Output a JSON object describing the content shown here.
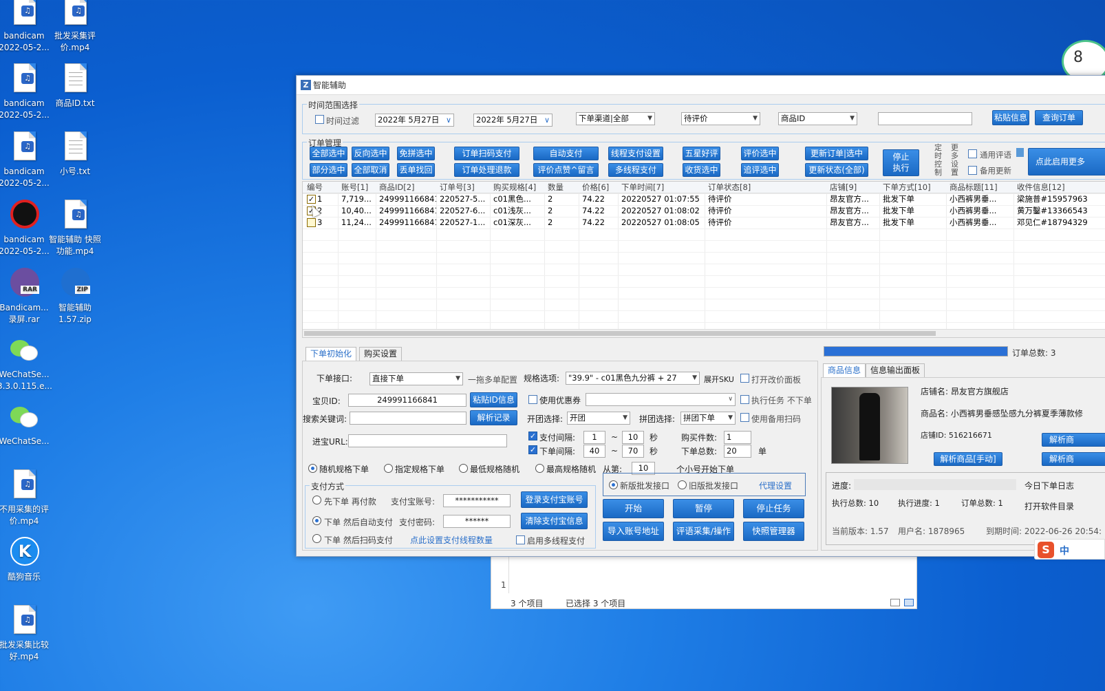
{
  "desktop": {
    "icons": [
      {
        "label": "bandicam 2022-05-2...",
        "type": "audio"
      },
      {
        "label": "批发采集评价.mp4",
        "type": "audio"
      },
      {
        "label": "bandicam 2022-05-2...",
        "type": "audio"
      },
      {
        "label": "商品ID.txt",
        "type": "text"
      },
      {
        "label": "bandicam 2022-05-2...",
        "type": "audio"
      },
      {
        "label": "小号.txt",
        "type": "text"
      },
      {
        "label": "bandicam 2022-05-2...",
        "type": "bandicam"
      },
      {
        "label": "智能辅助 快照功能.mp4",
        "type": "audio"
      },
      {
        "label": "Bandicam... 录屏.rar",
        "type": "rar",
        "badge": "RAR"
      },
      {
        "label": "智能辅助1.57.zip",
        "type": "zip",
        "badge": "ZIP"
      },
      {
        "label": "WeChatSe... 3.3.0.115.e...",
        "type": "wechat"
      },
      {
        "label": "WeChatSe...",
        "type": "wechat"
      },
      {
        "label": "不用采集的评价.mp4",
        "type": "audio"
      },
      {
        "label": "酷狗音乐",
        "type": "kugou",
        "glyph": "K"
      },
      {
        "label": "批发采集比较好.mp4",
        "type": "audio"
      }
    ]
  },
  "window": {
    "title": "智能辅助",
    "logo": "Z",
    "time_group": {
      "legend": "时间范围选择",
      "time_filter_label": "时间过滤",
      "date_from": "2022年 5月27日",
      "date_to": "2022年 5月27日",
      "channel": "下单渠道|全部",
      "status": "待评价",
      "id_type": "商品ID",
      "search_value": "",
      "paste_btn": "粘贴信息",
      "query_btn": "查询订单"
    },
    "order_group": {
      "legend": "订单管理",
      "buttons_row1": [
        "全部选中",
        "反向选中",
        "免拼选中",
        "订单扫码支付",
        "自动支付",
        "线程支付设置",
        "五星好评",
        "评价选中",
        "更新订单|选中"
      ],
      "buttons_row2": [
        "部分选中",
        "全部取消",
        "丢单找回",
        "订单处理退款",
        "评价点赞^留言",
        "多线程支付",
        "收货选中",
        "追评选中",
        "更新状态(全部)"
      ],
      "stop_btn": "停止执行",
      "vert1": "定时控制",
      "vert2": "更多设置",
      "general_review": "通用评语",
      "backup_update": "备用更新",
      "enable_more": "点此启用更多"
    },
    "table": {
      "headers": [
        "编号",
        "账号[1]",
        "商品ID[2]",
        "订单号[3]",
        "购买规格[4]",
        "数量",
        "价格[6]",
        "下单时间[7]",
        "订单状态[8]",
        "店铺[9]",
        "下单方式[10]",
        "商品标题[11]",
        "收件信息[12]"
      ],
      "rows": [
        {
          "checked": true,
          "cells": [
            "1",
            "7,719...",
            "249991166841",
            "220527-5...",
            "c01黑色...",
            "2",
            "74.22",
            "20220527 01:07:55",
            "待评价",
            "昂友官方...",
            "批发下单",
            "小西裤男垂...",
            "梁施普#15957963"
          ]
        },
        {
          "checked": true,
          "cells": [
            "2",
            "10,40...",
            "249991166841",
            "220527-6...",
            "c01浅灰...",
            "2",
            "74.22",
            "20220527 01:08:02",
            "待评价",
            "昂友官方...",
            "批发下单",
            "小西裤男垂...",
            "黄万鑿#13366543"
          ]
        },
        {
          "checked": false,
          "cells": [
            "3",
            "11,24...",
            "249991166841",
            "220527-1...",
            "c01深灰...",
            "2",
            "74.22",
            "20220527 01:08:05",
            "待评价",
            "昂友官方...",
            "批发下单",
            "小西裤男垂...",
            "邓见仁#18794329"
          ]
        }
      ]
    },
    "bottom": {
      "tabs": [
        "下单初始化",
        "购买设置"
      ],
      "progress_value": 1.0,
      "order_total_label": "订单总数: 3",
      "order_api_label": "下单接口:",
      "order_api_value": "直接下单",
      "multi_config": "一拖多单配置",
      "sku_label": "规格选项:",
      "sku_value": "\"39.9\" - c01黑色九分裤 + 27",
      "expand_sku": "展开SKU",
      "open_price_panel": "打开改价面板",
      "item_id_label": "宝贝ID:",
      "item_id_value": "249991166841",
      "paste_id_btn": "粘贴ID信息",
      "use_coupon": "使用优惠券",
      "exec_task": "执行任务 不下单",
      "keyword_label": "搜索关键词:",
      "parse_record_btn": "解析记录",
      "group_open_label": "开团选择:",
      "group_open_value": "开团",
      "group_join_label": "拼团选择:",
      "group_join_value": "拼团下单",
      "backup_scan": "使用备用扫码",
      "url_label": "进宝URL:",
      "pay_interval_label": "支付间隔:",
      "pay_interval_from": "1",
      "pay_interval_to": "10",
      "sec": "秒",
      "dash": "~",
      "order_interval_label": "下单间隔:",
      "order_interval_from": "40",
      "order_interval_to": "70",
      "buy_count_label": "购买件数:",
      "buy_count": "1",
      "order_total_count_label": "下单总数:",
      "order_total_count": "20",
      "unit": "单",
      "random_sku": "随机规格下单",
      "fixed_sku": "指定规格下单",
      "min_sku": "最低规格随机",
      "max_sku": "最高规格随机",
      "from_label": "从第:",
      "from_value": "10",
      "from_suffix": "个小号开始下单",
      "pay_legend": "支付方式",
      "pay_opt1": "先下单 再付款",
      "pay_opt2": "下单 然后自动支付",
      "pay_opt3": "下单 然后扫码支付",
      "alipay_acct_label": "支付宝账号:",
      "alipay_acct_value": "***********",
      "alipay_pwd_label": "支付密码:",
      "alipay_pwd_value": "******",
      "login_alipay_btn": "登录支付宝账号",
      "clear_alipay_btn": "清除支付宝信息",
      "thread_link": "点此设置支付线程数量",
      "multi_thread_pay": "启用多线程支付",
      "new_api": "新版批发接口",
      "old_api": "旧版批发接口",
      "proxy_settings": "代理设置",
      "start_btn": "开始",
      "pause_btn": "暂停",
      "stop_task_btn": "停止任务",
      "import_addr_btn": "导入账号地址",
      "review_btn": "评语采集/操作",
      "snapshot_btn": "快照管理器"
    },
    "info_panel": {
      "tabs": [
        "商品信息",
        "信息输出面板"
      ],
      "shop_label": "店铺名: 昂友官方旗舰店",
      "product_label": "商品名: 小西裤男垂感坠感九分裤夏季薄款修",
      "shop_id_label": "店铺ID: 516216671",
      "parse_btn": "解析商",
      "parse_manual_btn": "解析商品[手动]",
      "parse_btn2": "解析商",
      "progress_label": "进度:",
      "progress_value": 0.0,
      "today_log": "今日下单日志",
      "exec_total": "执行总数: 10",
      "exec_progress": "执行进度: 1",
      "order_total": "订单总数: 1",
      "open_dir": "打开软件目录",
      "version": "当前版本: 1.57",
      "username": "用户名: 1878965",
      "expiry": "到期时间: 2022-06-26 20:54:"
    }
  },
  "explorer": {
    "line_no": "1",
    "item_count": "3 个项目",
    "selected": "已选择 3 个项目"
  },
  "widget": {
    "value": "8"
  },
  "ime": {
    "logo": "S",
    "mode": "中"
  }
}
